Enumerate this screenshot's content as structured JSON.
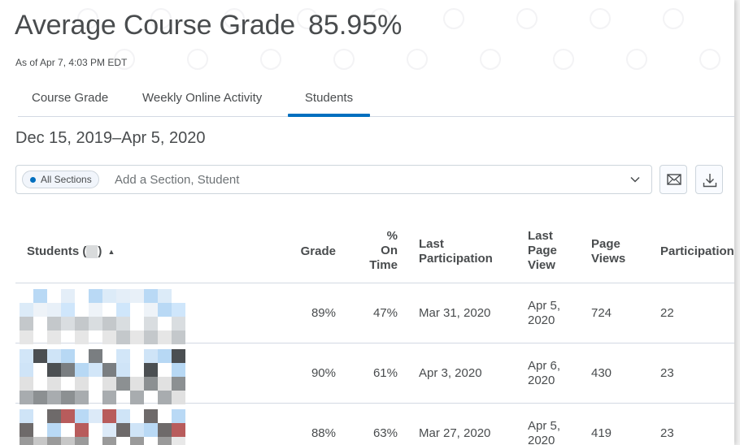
{
  "header": {
    "title": "Average Course Grade",
    "value": "85.95%",
    "as_of": "As of Apr 7, 4:03 PM EDT"
  },
  "tabs": [
    {
      "label": "Course Grade",
      "active": false
    },
    {
      "label": "Weekly Online Activity",
      "active": false
    },
    {
      "label": "Students",
      "active": true
    }
  ],
  "date_range": "Dec 15, 2019–Apr 5, 2020",
  "filter": {
    "chip_label": "All Sections",
    "placeholder": "Add a Section, Student",
    "dropdown_icon": "chevron-down-icon",
    "email_icon": "email-icon",
    "download_icon": "download-icon"
  },
  "table": {
    "columns": {
      "students": "Students (",
      "students_suffix": ")",
      "sort_indicator": "▲",
      "grade": "Grade",
      "on_time": [
        "%",
        "On",
        "Time"
      ],
      "last_participation": [
        "Last",
        "Participation"
      ],
      "last_page_view": [
        "Last",
        "Page",
        "View"
      ],
      "page_views": [
        "Page",
        "Views"
      ],
      "participation": "Participation"
    },
    "rows": [
      {
        "grade": "89%",
        "on_time": "47%",
        "last_participation": "Mar 31, 2020",
        "last_view": [
          "Apr 5,",
          "2020"
        ],
        "page_views": "724",
        "participation": "22"
      },
      {
        "grade": "90%",
        "on_time": "61%",
        "last_participation": "Apr 3, 2020",
        "last_view": [
          "Apr 6,",
          "2020"
        ],
        "page_views": "430",
        "participation": "23"
      },
      {
        "grade": "88%",
        "on_time": "63%",
        "last_participation": "Mar 27, 2020",
        "last_view": [
          "Apr 5,",
          "2020"
        ],
        "page_views": "419",
        "participation": "23"
      }
    ]
  },
  "colors": {
    "accent": "#006fbf",
    "text": "#494c4e",
    "border": "#d3d9e3"
  }
}
